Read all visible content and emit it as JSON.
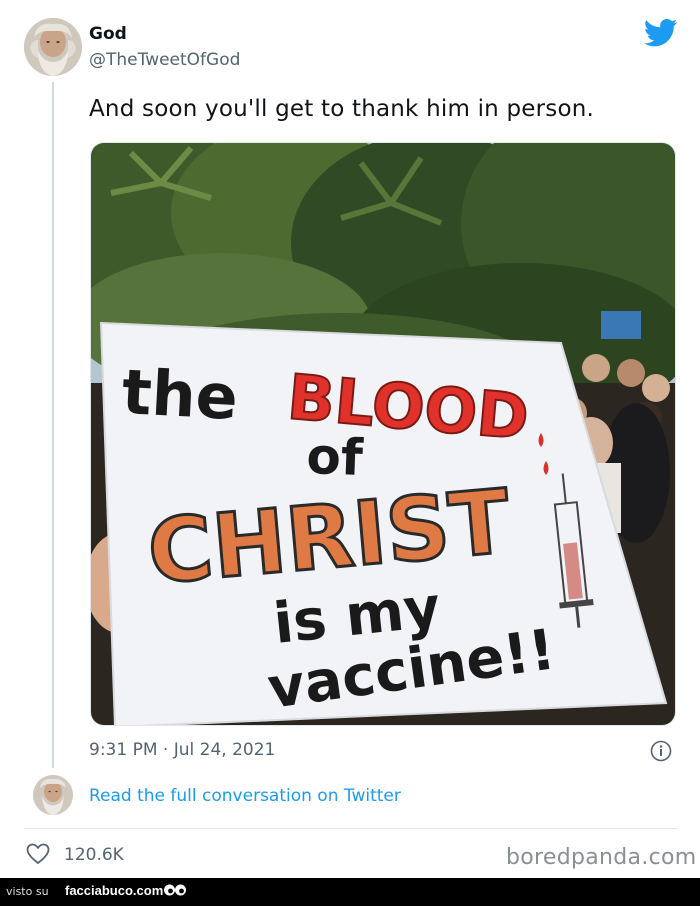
{
  "tweet": {
    "author_name": "God",
    "author_handle": "@TheTweetOfGod",
    "text": "And soon you'll get to thank him in person.",
    "timestamp": "9:31 PM · Jul 24, 2021",
    "read_full_link": "Read the full conversation on Twitter",
    "like_count": "120.6K"
  },
  "photo_sign": {
    "line1_word1": "the",
    "line1_word2": "BLOOD",
    "line2": "of",
    "line3": "CHRIST",
    "line4": "is my",
    "line5": "vaccine!!"
  },
  "watermark": "boredpanda.com",
  "footer": {
    "prefix": "visto su",
    "brand": "facciabuco.com"
  },
  "colors": {
    "link_blue": "#1d9bf0",
    "twitter_blue": "#1d9bf0",
    "muted_gray": "#536471",
    "sign_red": "#e0322b",
    "sign_orange": "#e07a45"
  },
  "icons": {
    "logo": "twitter-bird-icon",
    "info": "info-icon",
    "like": "heart-icon",
    "footer": "eyes-icon"
  }
}
